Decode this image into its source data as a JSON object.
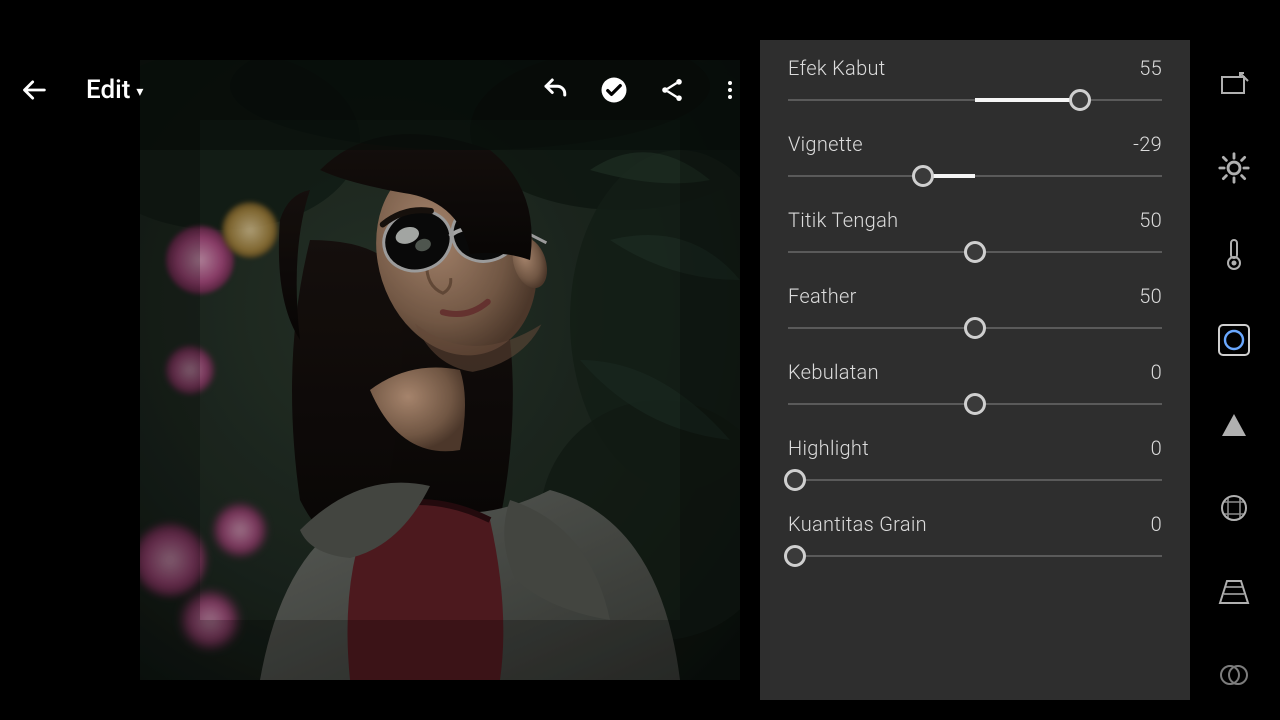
{
  "header": {
    "title": "Edit"
  },
  "sliders": [
    {
      "label": "",
      "value": "",
      "type": "center",
      "pos": 50,
      "fill_from": 50,
      "fill_to": 50,
      "truncated_top": true
    },
    {
      "label": "Efek Kabut",
      "value": "55",
      "type": "positive",
      "pos": 78,
      "fill_from": 50,
      "fill_to": 78
    },
    {
      "label": "Vignette",
      "value": "-29",
      "type": "negative",
      "pos": 36,
      "fill_from": 36,
      "fill_to": 50
    },
    {
      "label": "Titik Tengah",
      "value": "50",
      "type": "center",
      "pos": 50,
      "fill_from": 50,
      "fill_to": 50
    },
    {
      "label": "Feather",
      "value": "50",
      "type": "center",
      "pos": 50,
      "fill_from": 50,
      "fill_to": 50
    },
    {
      "label": "Kebulatan",
      "value": "0",
      "type": "center",
      "pos": 50,
      "fill_from": 50,
      "fill_to": 50
    },
    {
      "label": "Highlight",
      "value": "0",
      "type": "left",
      "pos": 2,
      "fill_from": 2,
      "fill_to": 2
    },
    {
      "label": "Kuantitas Grain",
      "value": "0",
      "type": "left",
      "pos": 2,
      "fill_from": 2,
      "fill_to": 2
    }
  ],
  "rail": [
    {
      "name": "crop-icon"
    },
    {
      "name": "brightness-icon"
    },
    {
      "name": "temperature-icon"
    },
    {
      "name": "optics-icon",
      "active": true
    },
    {
      "name": "triangle-icon"
    },
    {
      "name": "lens-icon"
    },
    {
      "name": "geometry-icon"
    },
    {
      "name": "effects-icon"
    }
  ]
}
